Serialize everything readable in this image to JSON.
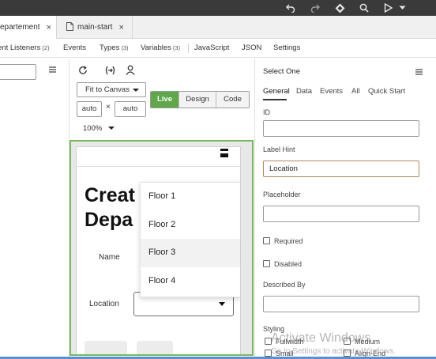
{
  "toolbar": {
    "icons": [
      "undo-icon",
      "redo-icon",
      "component-icon",
      "search-icon",
      "play-icon",
      "chevron-down-icon"
    ]
  },
  "tabs": [
    {
      "label": "epartement",
      "close": "×",
      "active": true
    },
    {
      "label": "main-start",
      "close": "×",
      "active": false
    }
  ],
  "subnav": {
    "event_listeners": {
      "label": "ent Listeners",
      "count": "(2)"
    },
    "events": {
      "label": "Events"
    },
    "types": {
      "label": "Types",
      "count": "(3)"
    },
    "variables": {
      "label": "Variables",
      "count": "(3)"
    },
    "javascript": {
      "label": "JavaScript"
    },
    "json": {
      "label": "JSON"
    },
    "settings": {
      "label": "Settings"
    }
  },
  "designer": {
    "fit_mode": "Fit to Canvas",
    "width_value": "auto",
    "height_value": "auto",
    "times": "×",
    "zoom": "100%",
    "modes": [
      "Live",
      "Design",
      "Code"
    ],
    "active_mode": "Live"
  },
  "page": {
    "title_line1": "Creat",
    "title_line2": "Depa",
    "name_label": "Name",
    "location_label": "Location",
    "dropdown_options": [
      "Floor 1",
      "Floor 2",
      "Floor 3",
      "Floor 4"
    ],
    "hovered_option": "Floor 3"
  },
  "properties": {
    "component": "Select One",
    "tabs": [
      "General",
      "Data",
      "Events",
      "All",
      "Quick Start"
    ],
    "active_tab": "General",
    "id_label": "ID",
    "id_value": "",
    "label_hint_label": "Label Hint",
    "label_hint_value": "Location",
    "placeholder_label": "Placeholder",
    "placeholder_value": "",
    "required_label": "Required",
    "disabled_label": "Disabled",
    "described_by_label": "Described By",
    "described_by_value": "",
    "styling_label": "Styling",
    "styling_options": [
      "Fullwidth",
      "Medium",
      "Small",
      "Align-End"
    ]
  },
  "watermark": {
    "line1": "Activate Windows",
    "line2": "Go to Settings to activate Windows."
  },
  "colors": {
    "topbar": "#3a3a3a",
    "accent_green": "#5ea84a",
    "canvas_border": "#78b95a",
    "focus_border": "#b8875a"
  }
}
